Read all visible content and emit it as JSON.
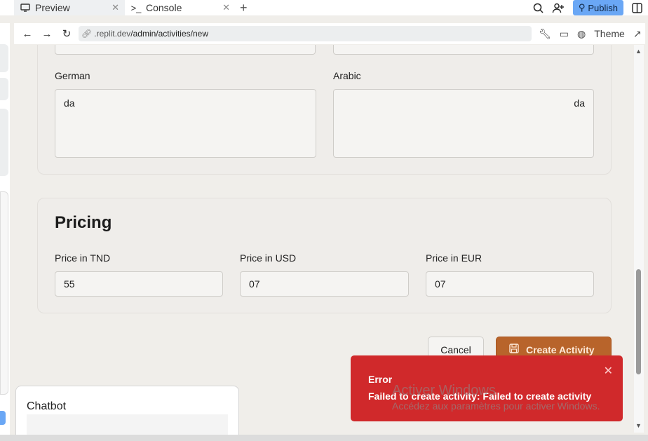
{
  "tabs": [
    {
      "label": "Preview",
      "icon": "monitor-icon",
      "active": true
    },
    {
      "label": "Console",
      "icon": "terminal-icon",
      "active": false
    }
  ],
  "toolbar": {
    "publish_label": "Publish"
  },
  "address": {
    "url_host": ".replit.dev",
    "url_path": "/admin/activities/new",
    "theme_label": "Theme"
  },
  "form": {
    "german_label": "German",
    "german_value": "da",
    "arabic_label": "Arabic",
    "arabic_value": "da",
    "pricing_title": "Pricing",
    "price_tnd_label": "Price in TND",
    "price_tnd_value": "55",
    "price_usd_label": "Price in USD",
    "price_usd_value": "07",
    "price_eur_label": "Price in EUR",
    "price_eur_value": "07",
    "cancel_label": "Cancel",
    "create_label": "Create Activity"
  },
  "chatbot": {
    "title": "Chatbot"
  },
  "toast": {
    "title": "Error",
    "message": "Failed to create activity: Failed to create activity"
  },
  "watermark": {
    "line1": "Activer Windows",
    "line2": "Accédez aux paramètres pour activer Windows."
  },
  "colors": {
    "accent": "#b8642b",
    "error": "#d0292b",
    "publish": "#6aa7f5"
  }
}
